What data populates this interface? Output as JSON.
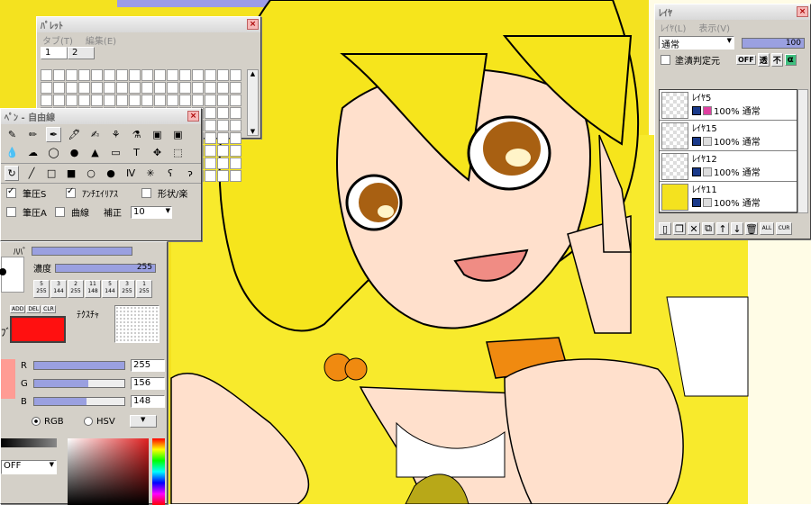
{
  "palette": {
    "title": "ﾊﾟﾚｯﾄ",
    "close": "×",
    "menu": [
      "タブ(T)",
      "編集(E)"
    ],
    "tabs": [
      "1",
      "2"
    ],
    "swatches": [
      "#fff",
      "#fff",
      "#fff",
      "#fff",
      "#fff",
      "#fff",
      "#fff",
      "#fff",
      "#fff",
      "#fff",
      "#fff",
      "#fff",
      "#fff",
      "#fff",
      "#fff",
      "#fff",
      "#fff",
      "#fff",
      "#fff",
      "#fff",
      "#fff",
      "#fff",
      "#fff",
      "#fff",
      "#fff",
      "#fff",
      "#fff",
      "#fff",
      "#fff",
      "#fff",
      "#fff",
      "#fff",
      "#fff",
      "#fff",
      "#fff",
      "#fff",
      "#fff",
      "#fff",
      "#fff",
      "#fff",
      "#fff",
      "#fff",
      "#fff",
      "#fff",
      "#fff",
      "#fff",
      "#fff",
      "#fff",
      "#b08080",
      "#b08080",
      "#b08080",
      "#fff",
      "#fff",
      "#22e060",
      "#fff",
      "#fff",
      "#fff",
      "#fff",
      "#fff",
      "#fff",
      "#fff",
      "#fff",
      "#fff",
      "#fff",
      "#fff",
      "#fff",
      "#fff",
      "#fff",
      "#fff",
      "#fff",
      "#fff",
      "#fff",
      "#fff",
      "#fff",
      "#fff",
      "#fff",
      "#fff",
      "#fff",
      "#fff",
      "#fff",
      "#fff",
      "#fff",
      "#fff",
      "#fff",
      "#fff",
      "#fff",
      "#fff",
      "#fff",
      "#fff",
      "#fff",
      "#fff",
      "#fff",
      "#fff",
      "#fff",
      "#fff",
      "#fff",
      "#fff",
      "#fff",
      "#fff",
      "#fff",
      "#fff",
      "#fff",
      "#fff",
      "#fff",
      "#fff",
      "#fff",
      "#fff",
      "#fff",
      "#fff",
      "#fff",
      "#fff",
      "#fff",
      "#fff",
      "#fff",
      "#fff",
      "#fff",
      "#fff",
      "#fff",
      "#fff",
      "#fff",
      "#fff",
      "#fff",
      "#fff",
      "#fff",
      "#fff",
      "#fff",
      "#fff",
      "#fff",
      "#fff",
      "#fff",
      "#fff",
      "#fff",
      "#fff",
      "#fff",
      "#fff",
      "#fff",
      "#fff",
      "#fff",
      "#fff",
      "#fff",
      "#fff",
      "#fff",
      "#fff",
      "#fff",
      "#fff",
      "#fff"
    ]
  },
  "pen": {
    "title": "ﾍﾟﾝ - 自由線",
    "close": "×",
    "options": {
      "pressure_s": "筆圧S",
      "antialias": "ｱﾝﾁｴｲﾘｱｽ",
      "shape": "形状/楽",
      "pressure_a": "筆圧A",
      "curve": "曲線",
      "correct_label": "補正",
      "correct_value": "10"
    },
    "density_label": "濃度",
    "density_value": "255",
    "width_label": "ﾊﾊﾞ",
    "presets": [
      [
        "5",
        "255"
      ],
      [
        "3",
        "144"
      ],
      [
        "2",
        "255"
      ],
      [
        "11",
        "148"
      ],
      [
        "5",
        "144"
      ],
      [
        "3",
        "255"
      ],
      [
        "1",
        "255"
      ]
    ],
    "add": "ADD",
    "del": "DEL",
    "clr": "CLR",
    "texture_label": "ﾃｸｽﾁｬ",
    "side_label": "ﾌﾞ",
    "r_label": "R",
    "r_value": "255",
    "g_label": "G",
    "g_value": "156",
    "b_label": "B",
    "b_value": "148",
    "rgb": "RGB",
    "hsv": "HSV",
    "off": "OFF",
    "fg_color": "#ff1010",
    "preview_color": "#ff9c94"
  },
  "layers": {
    "title": "ﾚｲﾔ",
    "close": "×",
    "menu": [
      "ﾚｲﾔ(L)",
      "表示(V)"
    ],
    "mode": "通常",
    "opacity": "100",
    "protect_label": "塗潰判定元",
    "modes": [
      "OFF",
      "透",
      "不",
      "α"
    ],
    "items": [
      {
        "name": "ﾚｲﾔ5",
        "info": "100% 通常"
      },
      {
        "name": "ﾚｲﾔ15",
        "info": "100% 通常"
      },
      {
        "name": "ﾚｲﾔ12",
        "info": "100% 通常"
      },
      {
        "name": "ﾚｲﾔ11",
        "info": "100% 通常"
      }
    ],
    "buttons": [
      "ALL",
      "CUR"
    ]
  }
}
